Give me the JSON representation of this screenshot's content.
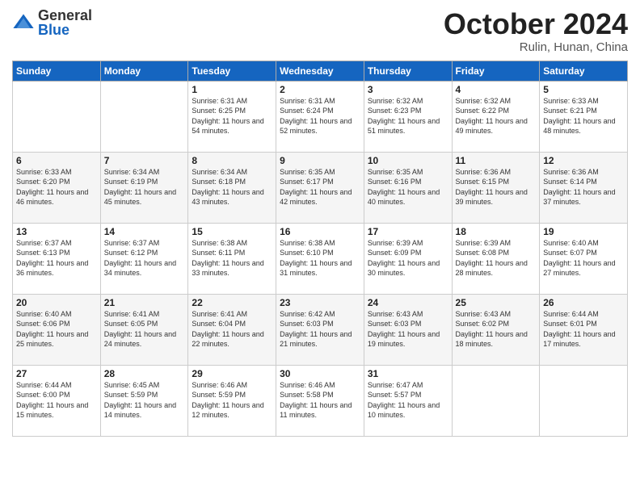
{
  "header": {
    "logo": {
      "general": "General",
      "blue": "Blue"
    },
    "month": "October 2024",
    "location": "Rulin, Hunan, China"
  },
  "days_of_week": [
    "Sunday",
    "Monday",
    "Tuesday",
    "Wednesday",
    "Thursday",
    "Friday",
    "Saturday"
  ],
  "weeks": [
    [
      {
        "day": "",
        "info": ""
      },
      {
        "day": "",
        "info": ""
      },
      {
        "day": "1",
        "info": "Sunrise: 6:31 AM\nSunset: 6:25 PM\nDaylight: 11 hours and 54 minutes."
      },
      {
        "day": "2",
        "info": "Sunrise: 6:31 AM\nSunset: 6:24 PM\nDaylight: 11 hours and 52 minutes."
      },
      {
        "day": "3",
        "info": "Sunrise: 6:32 AM\nSunset: 6:23 PM\nDaylight: 11 hours and 51 minutes."
      },
      {
        "day": "4",
        "info": "Sunrise: 6:32 AM\nSunset: 6:22 PM\nDaylight: 11 hours and 49 minutes."
      },
      {
        "day": "5",
        "info": "Sunrise: 6:33 AM\nSunset: 6:21 PM\nDaylight: 11 hours and 48 minutes."
      }
    ],
    [
      {
        "day": "6",
        "info": "Sunrise: 6:33 AM\nSunset: 6:20 PM\nDaylight: 11 hours and 46 minutes."
      },
      {
        "day": "7",
        "info": "Sunrise: 6:34 AM\nSunset: 6:19 PM\nDaylight: 11 hours and 45 minutes."
      },
      {
        "day": "8",
        "info": "Sunrise: 6:34 AM\nSunset: 6:18 PM\nDaylight: 11 hours and 43 minutes."
      },
      {
        "day": "9",
        "info": "Sunrise: 6:35 AM\nSunset: 6:17 PM\nDaylight: 11 hours and 42 minutes."
      },
      {
        "day": "10",
        "info": "Sunrise: 6:35 AM\nSunset: 6:16 PM\nDaylight: 11 hours and 40 minutes."
      },
      {
        "day": "11",
        "info": "Sunrise: 6:36 AM\nSunset: 6:15 PM\nDaylight: 11 hours and 39 minutes."
      },
      {
        "day": "12",
        "info": "Sunrise: 6:36 AM\nSunset: 6:14 PM\nDaylight: 11 hours and 37 minutes."
      }
    ],
    [
      {
        "day": "13",
        "info": "Sunrise: 6:37 AM\nSunset: 6:13 PM\nDaylight: 11 hours and 36 minutes."
      },
      {
        "day": "14",
        "info": "Sunrise: 6:37 AM\nSunset: 6:12 PM\nDaylight: 11 hours and 34 minutes."
      },
      {
        "day": "15",
        "info": "Sunrise: 6:38 AM\nSunset: 6:11 PM\nDaylight: 11 hours and 33 minutes."
      },
      {
        "day": "16",
        "info": "Sunrise: 6:38 AM\nSunset: 6:10 PM\nDaylight: 11 hours and 31 minutes."
      },
      {
        "day": "17",
        "info": "Sunrise: 6:39 AM\nSunset: 6:09 PM\nDaylight: 11 hours and 30 minutes."
      },
      {
        "day": "18",
        "info": "Sunrise: 6:39 AM\nSunset: 6:08 PM\nDaylight: 11 hours and 28 minutes."
      },
      {
        "day": "19",
        "info": "Sunrise: 6:40 AM\nSunset: 6:07 PM\nDaylight: 11 hours and 27 minutes."
      }
    ],
    [
      {
        "day": "20",
        "info": "Sunrise: 6:40 AM\nSunset: 6:06 PM\nDaylight: 11 hours and 25 minutes."
      },
      {
        "day": "21",
        "info": "Sunrise: 6:41 AM\nSunset: 6:05 PM\nDaylight: 11 hours and 24 minutes."
      },
      {
        "day": "22",
        "info": "Sunrise: 6:41 AM\nSunset: 6:04 PM\nDaylight: 11 hours and 22 minutes."
      },
      {
        "day": "23",
        "info": "Sunrise: 6:42 AM\nSunset: 6:03 PM\nDaylight: 11 hours and 21 minutes."
      },
      {
        "day": "24",
        "info": "Sunrise: 6:43 AM\nSunset: 6:03 PM\nDaylight: 11 hours and 19 minutes."
      },
      {
        "day": "25",
        "info": "Sunrise: 6:43 AM\nSunset: 6:02 PM\nDaylight: 11 hours and 18 minutes."
      },
      {
        "day": "26",
        "info": "Sunrise: 6:44 AM\nSunset: 6:01 PM\nDaylight: 11 hours and 17 minutes."
      }
    ],
    [
      {
        "day": "27",
        "info": "Sunrise: 6:44 AM\nSunset: 6:00 PM\nDaylight: 11 hours and 15 minutes."
      },
      {
        "day": "28",
        "info": "Sunrise: 6:45 AM\nSunset: 5:59 PM\nDaylight: 11 hours and 14 minutes."
      },
      {
        "day": "29",
        "info": "Sunrise: 6:46 AM\nSunset: 5:59 PM\nDaylight: 11 hours and 12 minutes."
      },
      {
        "day": "30",
        "info": "Sunrise: 6:46 AM\nSunset: 5:58 PM\nDaylight: 11 hours and 11 minutes."
      },
      {
        "day": "31",
        "info": "Sunrise: 6:47 AM\nSunset: 5:57 PM\nDaylight: 11 hours and 10 minutes."
      },
      {
        "day": "",
        "info": ""
      },
      {
        "day": "",
        "info": ""
      }
    ]
  ]
}
